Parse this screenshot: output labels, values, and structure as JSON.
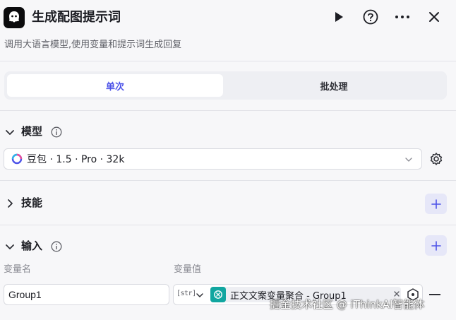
{
  "header": {
    "title": "生成配图提示词",
    "subtitle": "调用大语言模型,使用变量和提示词生成回复",
    "icons": [
      "play-icon",
      "help-icon",
      "more-icon",
      "close-icon"
    ]
  },
  "tabs": [
    {
      "label": "单次",
      "active": true
    },
    {
      "label": "批处理",
      "active": false
    }
  ],
  "sections": {
    "model": {
      "label": "模型",
      "expanded": true
    },
    "skills": {
      "label": "技能",
      "expanded": false
    },
    "input": {
      "label": "输入",
      "expanded": true
    }
  },
  "model_select": {
    "value": "豆包 · 1.5 · Pro · 32k"
  },
  "input_table": {
    "col_name": "变量名",
    "col_value": "变量值",
    "rows": [
      {
        "name": "Group1",
        "type": "[str]",
        "value_ref": "正文文案变量聚合 - Group1"
      }
    ]
  },
  "watermark": "掘金技术社区 @ iThinkAI智能体",
  "colors": {
    "accent": "#4d53e8",
    "ref_icon": "#11a6a0",
    "background": "#f7f7f9"
  }
}
